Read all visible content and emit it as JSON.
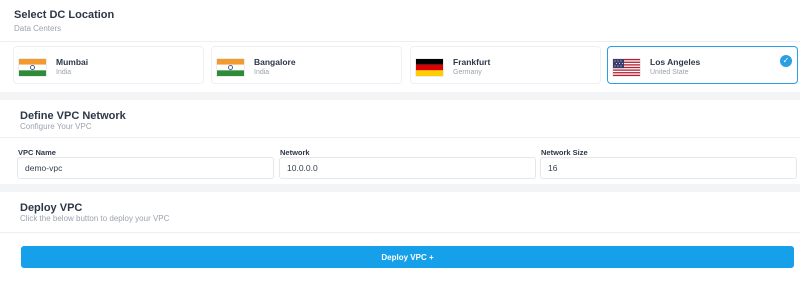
{
  "dc_location": {
    "title": "Select DC Location",
    "subtitle": "Data Centers",
    "locations": [
      {
        "city": "Mumbai",
        "country": "India",
        "flag": "india-flag",
        "selected": false
      },
      {
        "city": "Bangalore",
        "country": "India",
        "flag": "india-flag",
        "selected": false
      },
      {
        "city": "Frankfurt",
        "country": "Germany",
        "flag": "germany-flag",
        "selected": false
      },
      {
        "city": "Los Angeles",
        "country": "United State",
        "flag": "usa-flag",
        "selected": true
      }
    ]
  },
  "vpc_network": {
    "title": "Define VPC Network",
    "subtitle": "Configure Your VPC",
    "fields": [
      {
        "label": "VPC Name",
        "value": "demo-vpc"
      },
      {
        "label": "Network",
        "value": "10.0.0.0"
      },
      {
        "label": "Network Size",
        "value": "16"
      }
    ]
  },
  "deploy": {
    "title": "Deploy VPC",
    "subtitle": "Click the below button to deploy your VPC",
    "button_label": "Deploy VPC +"
  },
  "colors": {
    "accent": "#16a0ea",
    "selected_border": "#2aa0e4",
    "background": "#f3f4f6"
  }
}
